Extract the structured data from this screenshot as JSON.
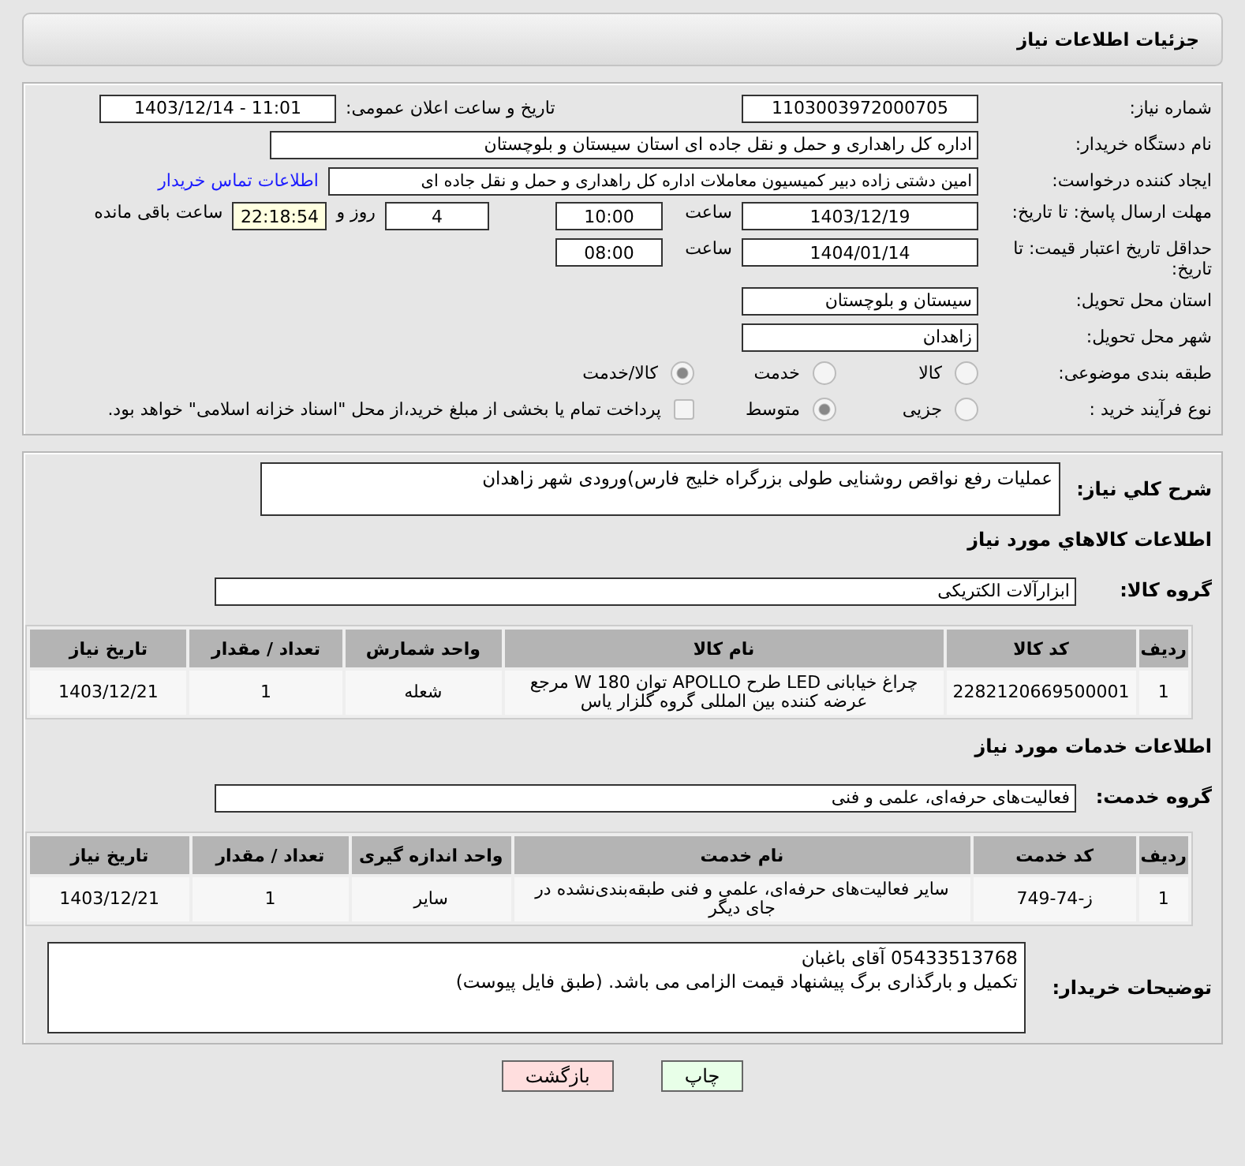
{
  "header": {
    "title": "جزئیات اطلاعات نیاز"
  },
  "need_number": {
    "label": "شماره نیاز:",
    "value": "1103003972000705"
  },
  "announce_datetime": {
    "label": "تاریخ و ساعت اعلان عمومی:",
    "value": "1403/12/14 - 11:01"
  },
  "buyer_org": {
    "label": "نام دستگاه خریدار:",
    "value": "اداره کل راهداری و حمل و نقل جاده ای استان سیستان و بلوچستان"
  },
  "requester": {
    "label": "ایجاد کننده درخواست:",
    "value": "امین دشتی زاده دبیر کمیسیون معاملات اداره کل راهداری و حمل و نقل جاده ای",
    "link": "اطلاعات تماس خریدار"
  },
  "response_deadline": {
    "label": "مهلت ارسال پاسخ: تا تاریخ:",
    "date": "1403/12/19",
    "time_label": "ساعت",
    "time": "10:00",
    "days": "4",
    "days_label": "روز و",
    "remaining": "22:18:54",
    "remaining_label": "ساعت باقی مانده"
  },
  "price_validity": {
    "label": "حداقل تاریخ اعتبار قیمت: تا تاریخ:",
    "date": "1404/01/14",
    "time_label": "ساعت",
    "time": "08:00"
  },
  "province": {
    "label": "استان محل تحویل:",
    "value": "سیستان و بلوچستان"
  },
  "city": {
    "label": "شهر محل تحویل:",
    "value": "زاهدان"
  },
  "category": {
    "label": "طبقه بندی موضوعی:",
    "options": [
      {
        "label": "کالا",
        "selected": false
      },
      {
        "label": "خدمت",
        "selected": false
      },
      {
        "label": "کالا/خدمت",
        "selected": true
      }
    ]
  },
  "purchase_type": {
    "label": "نوع فرآیند خرید :",
    "options": [
      {
        "label": "جزیی",
        "selected": false
      },
      {
        "label": "متوسط",
        "selected": true
      }
    ],
    "payment_note": {
      "label": "پرداخت تمام یا بخشی از مبلغ خرید،از محل \"اسناد خزانه اسلامی\" خواهد بود.",
      "checked": false
    }
  },
  "description": {
    "label": "شرح کلي نياز:",
    "value": "عملیات رفع نواقص روشنایی طولی بزرگراه خلیج فارس)ورودی شهر زاهدان"
  },
  "goods": {
    "heading": "اطلاعات کالاهاي مورد نياز",
    "group_label": "گروه کالا:",
    "group": "ابزارآلات الکتریکی",
    "columns": [
      "ردیف",
      "کد کالا",
      "نام کالا",
      "واحد شمارش",
      "تعداد / مقدار",
      "تاریخ نیاز"
    ],
    "rows": [
      [
        "1",
        "2282120669500001",
        "چراغ خیابانی LED طرح APOLLO توان 180 W مرجع عرضه کننده بین المللی گروه گلزار یاس",
        "شعله",
        "1",
        "1403/12/21"
      ]
    ]
  },
  "services": {
    "heading": "اطلاعات خدمات مورد نیاز",
    "group_label": "گروه خدمت:",
    "group": "فعالیت‌های حرفه‌ای، علمی و فنی",
    "columns": [
      "ردیف",
      "کد خدمت",
      "نام خدمت",
      "واحد اندازه گیری",
      "تعداد / مقدار",
      "تاریخ نیاز"
    ],
    "rows": [
      [
        "1",
        "ز-74-749",
        "سایر فعالیت‌های حرفه‌ای، علمی و فنی طبقه‌بندی‌نشده در جای دیگر",
        "سایر",
        "1",
        "1403/12/21"
      ]
    ]
  },
  "buyer_notes": {
    "label": "توضیحات خریدار:",
    "value": "05433513768 آقای باغبان\nتکمیل و بارگذاری برگ پیشنهاد قیمت الزامی می باشد. (طبق فایل پیوست)"
  },
  "buttons": [
    {
      "label": "چاپ",
      "kind": "print"
    },
    {
      "label": "بازگشت",
      "kind": "back"
    }
  ]
}
